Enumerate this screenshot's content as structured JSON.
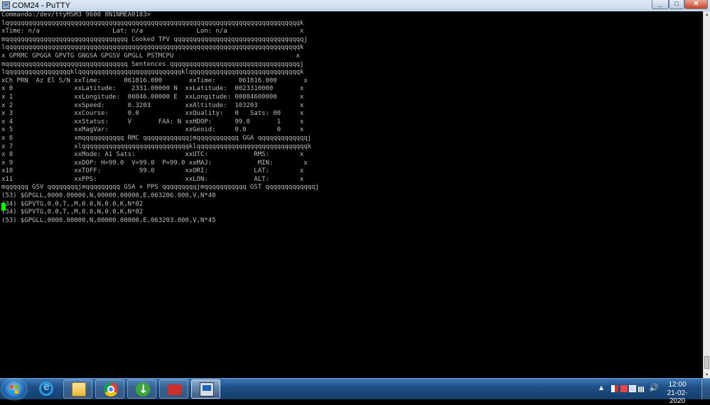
{
  "window": {
    "title": "COM24 - PuTTY",
    "minimize_glyph": "_",
    "maximize_glyph": "□",
    "close_glyph": "✕"
  },
  "terminal": {
    "lines": [
      "Commando:/dev/ttyMSM3 9600 8N1NMEA0183>",
      "lqqqqqqqqqqqqqqqqqqqqqqqqqqqqqqqqqqqqqqqqqqqqqqqqqqqqqqqqqqqqqqqqqqqqqqqqqqqqqk",
      "xTime: n/a                   Lat: n/a              Lon: n/a                   x",
      "mqqqqqqqqqqqqqqqqqqqqqqqqqqqqqqqq Cooked TPV qqqqqqqqqqqqqqqqqqqqqqqqqqqqqqqqqqj",
      "lqqqqqqqqqqqqqqqqqqqqqqqqqqqqqqqqqqqqqqqqqqqqqqqqqqqqqqqqqqqqqqqqqqqqqqqqqqqqqk",
      "x GPRMC GPGGA GPVTG GNGSA GPGSV GPGLL PSTMCPU                                x",
      "mqqqqqqqqqqqqqqqqqqqqqqqqqqqqqqqq Sentences qqqqqqqqqqqqqqqqqqqqqqqqqqqqqqqqqqj",
      "lqqqqqqqqqqqqqqqqqklqqqqqqqqqqqqqqqqqqqqqqqqqqqklqqqqqqqqqqqqqqqqqqqqqqqqqqqqqk",
      "xCh PRN  Az El S/N xxTime:      061816.000       xxTime:      061816.000       x",
      "x 0                xxLatitude:    2331.00000 N  xxLatitude:  0023310000       x",
      "x 1                xxLongitude:  00846.00000 E  xxLongitude: 00084600000      x",
      "x 2                xxSpeed:      0.3203         xxAltitude:  103203           x",
      "x 3                xxCourse:     0.0            xxQuality:   0   Sats: 00     x",
      "x 4                xxStatus:     V       FAA: N xxHDOP:      99.0       1     x",
      "x 5                xxMagVar:                    xxGeoid:     0.0        0     x",
      "x 6                xmqqqqqqqqqqq RMC qqqqqqqqqqqqjmqqqqqqqqqqq GGA qqqqqqqqqqqqqj",
      "x 7                xlqqqqqqqqqqqqqqqqqqqqqqqqqqqqklqqqqqqqqqqqqqqqqqqqqqqqqqqqqqk",
      "x 8                xxMode: A1 Sats:             xxUTC:            RMS:        x",
      "x 9                xxDOP: H=99.0  V=99.0  P=99.0 xxMAJ:            MIN:        x",
      "x10                xxTOFF:          99.0        xxORI:            LAT:        x",
      "x11                xxPPS:                       xxLON:            ALT:        x",
      "mqqqqqq GSV qqqqqqqqjmqqqqqqqqq GSA + PPS qqqqqqqqqjmqqqqqqqqqqq GST qqqqqqqqqqqqqj",
      "(53) $GPGLL,0000.00000,N,00000.00000,E,063206.000,V,N*40",
      "(34) $GPVTG,0.0,T,,M,0.0,N,0.0,K,N*02",
      "(34) $GPVTG,0.0,T,,M,0.0,N,0.0,K,N*02",
      "(53) $GPGLL,0000.00000,N,00000.00000,E,063203.000,V,N*45"
    ]
  },
  "colors": {
    "terminal_bg": "#000000",
    "terminal_fg": "#bbbbbb",
    "cursor": "#00ff00"
  },
  "taskbar": {
    "pinned": [
      "start-button",
      "internet-explorer-icon",
      "file-explorer-icon",
      "chrome-icon",
      "download-manager-icon",
      "toolbox-icon",
      "putty-icon"
    ],
    "tray_arrow": "▲",
    "volume_glyph": "🔊",
    "clock_time": "12:00",
    "clock_date": "21-02-2020"
  }
}
